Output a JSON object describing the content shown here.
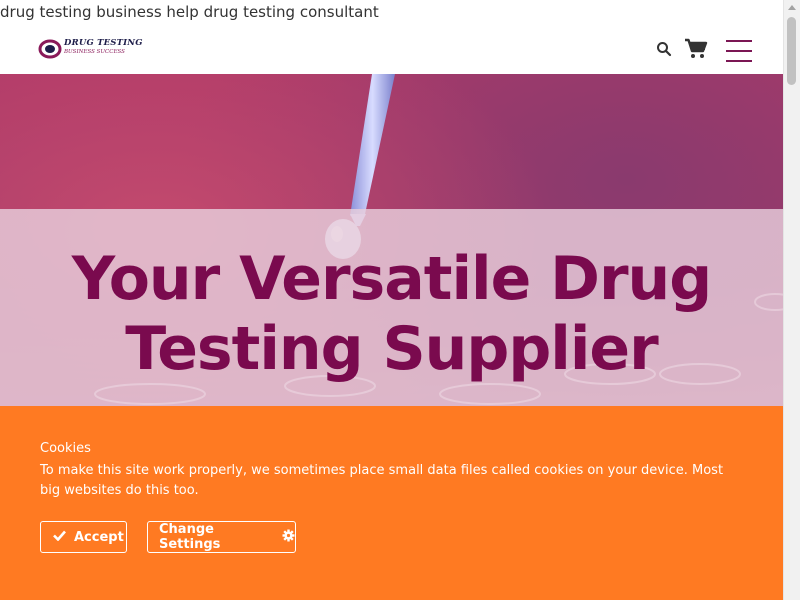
{
  "page": {
    "top_text": "drug testing business help drug testing consultant"
  },
  "header": {
    "logo_line1": "DRUG TESTING",
    "logo_line2": "BUSINESS SUCCESS",
    "icons": [
      "search-icon",
      "shopping-cart-icon",
      "hamburger-menu-icon"
    ]
  },
  "hero": {
    "title_line1": "Your Versatile Drug",
    "title_line2": "Testing Supplier"
  },
  "cookie_banner": {
    "title": "Cookies",
    "text": "To make this site work properly, we sometimes place small data files called cookies on your device. Most big websites do this too.",
    "accept_label": "Accept",
    "settings_label": "Change Settings",
    "accept_icon": "check-icon",
    "settings_icon": "gear-icon"
  },
  "colors": {
    "brand": "#7a0a4e",
    "cookie_bg": "#ff7a22",
    "menu": "#7b1654"
  }
}
